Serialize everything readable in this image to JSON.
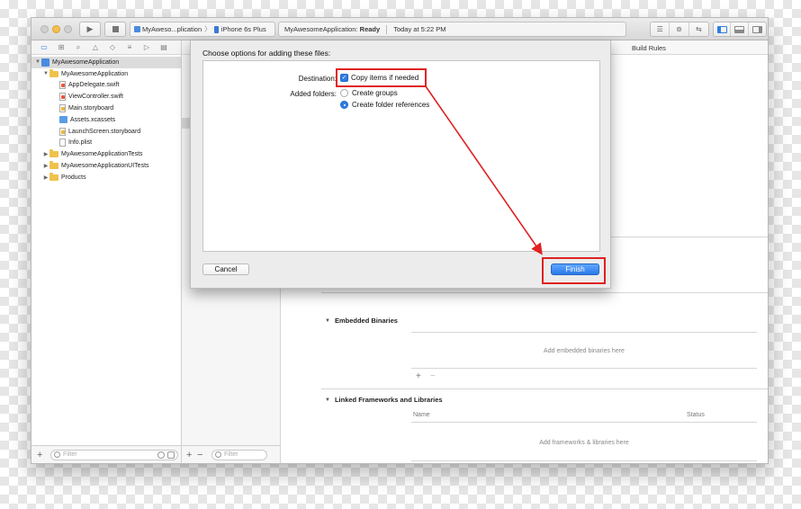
{
  "toolbar": {
    "scheme_app": "MyAweso...plication",
    "scheme_sep": "〉",
    "scheme_device": "iPhone 6s Plus",
    "status_project": "MyAwesomeApplication:",
    "status_state": "Ready",
    "status_time": "Today at 5:22 PM"
  },
  "navigator": {
    "project": "MyAwesomeApplication",
    "group": "MyAwesomeApplication",
    "files": [
      "AppDelegate.swift",
      "ViewController.swift",
      "Main.storyboard",
      "Assets.xcassets",
      "LaunchScreen.storyboard",
      "Info.plist"
    ],
    "tests": "MyAwesomeApplicationTests",
    "uitests": "MyAwesomeApplicationUITests",
    "products": "Products",
    "filter_placeholder": "Filter"
  },
  "outline": {
    "filter_placeholder": "Filter"
  },
  "editor": {
    "build_rules_tab": "Build Rules",
    "embedded_title": "Embedded Binaries",
    "embedded_empty": "Add embedded binaries here",
    "linked_title": "Linked Frameworks and Libraries",
    "col_name": "Name",
    "col_status": "Status",
    "linked_empty": "Add frameworks & libraries here"
  },
  "sheet": {
    "title": "Choose options for adding these files:",
    "destination_label": "Destination:",
    "copy_items": "Copy items if needed",
    "copy_checked": true,
    "folders_label": "Added folders:",
    "create_groups": "Create groups",
    "create_folder_refs": "Create folder references",
    "selected_folder_option": "Create folder references",
    "cancel": "Cancel",
    "finish": "Finish"
  },
  "icons": {
    "nav_tabs": [
      "folder-icon",
      "symbol-icon",
      "search-icon",
      "warning-icon",
      "test-icon",
      "debug-icon",
      "breakpoint-icon",
      "report-icon"
    ]
  },
  "colors": {
    "accent": "#2f7de1",
    "annotation": "#e02222"
  }
}
